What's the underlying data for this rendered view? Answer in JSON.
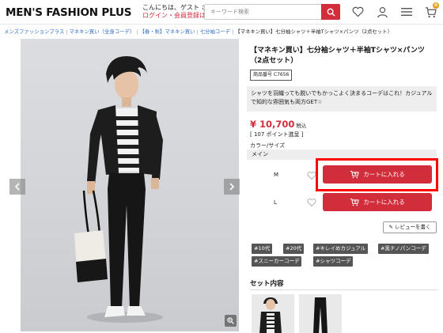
{
  "header": {
    "logo": "MEN'S FASHION PLUS",
    "greeting": "こんにちは、ゲスト さん",
    "login_link": "ログイン・会員登録はこちら",
    "search_placeholder": "キーワード検索",
    "cart_count": "0",
    "icons": [
      "search-icon",
      "heart-icon",
      "user-icon",
      "menu-icon",
      "cart-icon"
    ]
  },
  "breadcrumb": [
    {
      "label": "メンズファッションプラス",
      "link": true
    },
    {
      "label": "マネキン買い（全身コーデ）",
      "link": true
    },
    {
      "label": "【春・秋】マネキン買い",
      "link": true
    },
    {
      "label": "七分袖コーデ",
      "link": true
    },
    {
      "label": "【マネキン買い】七分袖シャツ＋半袖Tシャツ×パンツ（2点セット）",
      "link": false
    }
  ],
  "product": {
    "title": "【マネキン買い】七分袖シャツ＋半袖Tシャツ×パンツ（2点セット）",
    "code": "商品番号 C7656",
    "description": "シャツを羽織っても脱いでもかっこよく決まるコーデはこれ！カジュアルで知的な雰囲気も両方GET☆",
    "price": "¥ 10,700",
    "tax_label": "税込",
    "points": "[ 107 ポイント進呈 ]",
    "variant_label": "カラー/サイズ",
    "color": "メイン",
    "sizes": [
      {
        "size": "M",
        "cart_label": "カートに入れる"
      },
      {
        "size": "L",
        "cart_label": "カートに入れる"
      }
    ],
    "review_label": "レビューを書く"
  },
  "tags": [
    "#10代",
    "#20代",
    "#キレイめカジュアル",
    "#黒チノパンコーデ",
    "#スニーカーコーデ",
    "#シャツコーデ"
  ],
  "set": {
    "title": "セット内容"
  },
  "colors": {
    "brand_red": "#d12d3b",
    "highlight_red": "#ff0000",
    "tag_bg": "#555555"
  }
}
